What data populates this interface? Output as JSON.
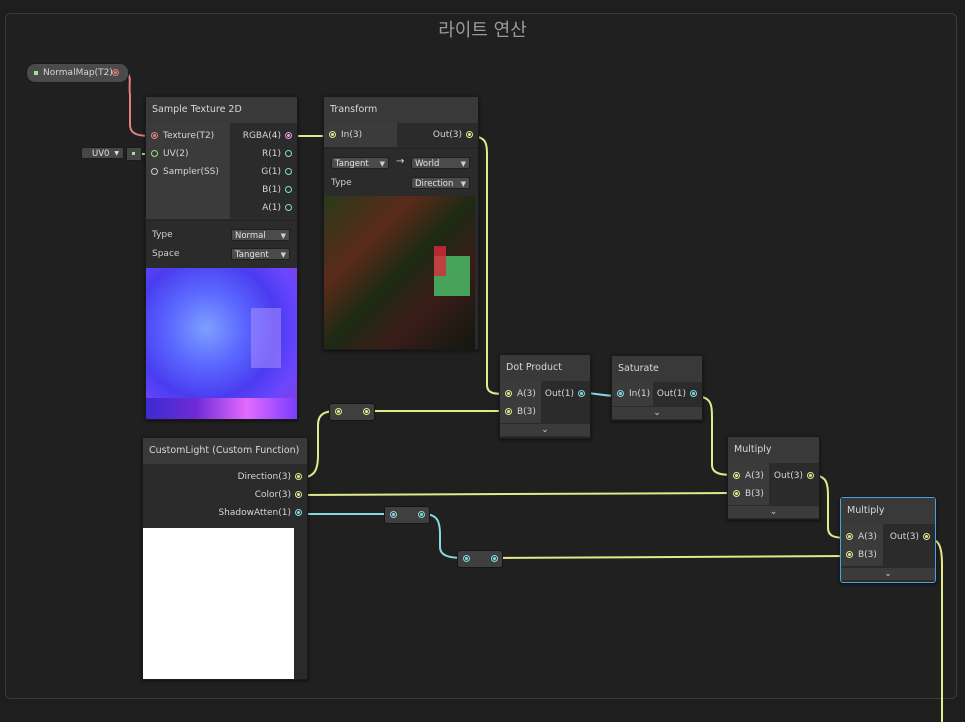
{
  "group": {
    "title": "라이트 연산"
  },
  "colors": {
    "normalmap_wire": "#e67f7f",
    "vec3_wire": "#e4e98c",
    "vec1_wire": "#86dbe1",
    "vec2_wire": "#9be38c",
    "selection": "#4aa3e0"
  },
  "property": {
    "label": "NormalMap(T2)",
    "icon": "square-icon"
  },
  "uv_input": {
    "label": "UV0",
    "icon": "chevron-down-icon"
  },
  "sample_texture": {
    "title": "Sample Texture 2D",
    "inputs": [
      "Texture(T2)",
      "UV(2)",
      "Sampler(SS)"
    ],
    "outputs": [
      "RGBA(4)",
      "R(1)",
      "G(1)",
      "B(1)",
      "A(1)"
    ],
    "type_label": "Type",
    "type_value": "Normal",
    "space_label": "Space",
    "space_value": "Tangent"
  },
  "transform": {
    "title": "Transform",
    "input": "In(3)",
    "output": "Out(3)",
    "from_value": "Tangent",
    "arrow": "→",
    "to_value": "World",
    "type_label": "Type",
    "type_value": "Direction"
  },
  "dot_product": {
    "title": "Dot Product",
    "inputs": [
      "A(3)",
      "B(3)"
    ],
    "output": "Out(1)"
  },
  "saturate": {
    "title": "Saturate",
    "input": "In(1)",
    "output": "Out(1)"
  },
  "multiply1": {
    "title": "Multiply",
    "inputs": [
      "A(3)",
      "B(3)"
    ],
    "output": "Out(3)"
  },
  "multiply2": {
    "title": "Multiply",
    "inputs": [
      "A(3)",
      "B(3)"
    ],
    "output": "Out(3)"
  },
  "custom_light": {
    "title": "CustomLight (Custom Function)",
    "outputs": [
      "Direction(3)",
      "Color(3)",
      "ShadowAtten(1)"
    ]
  }
}
